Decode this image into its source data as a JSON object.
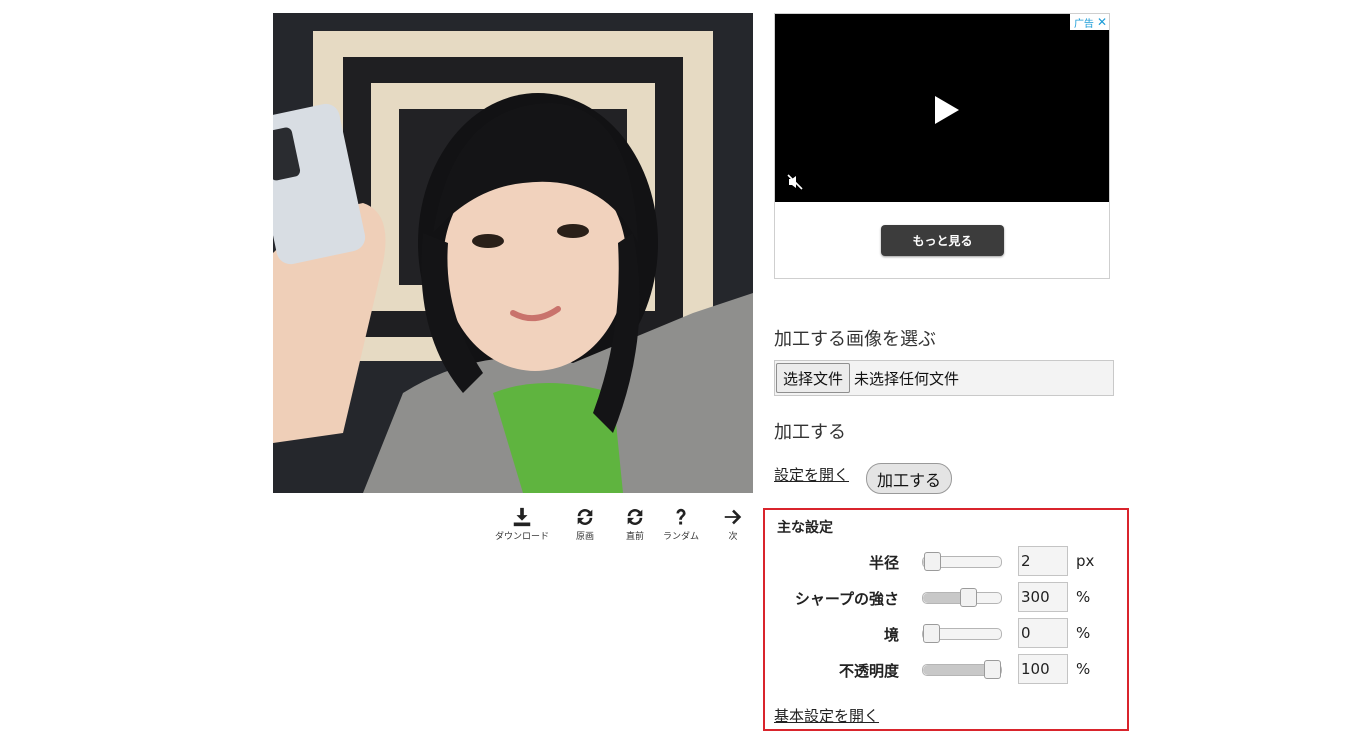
{
  "toolbar": {
    "items": [
      {
        "label": "ダウンロード",
        "icon": "download-icon"
      },
      {
        "label": "原画",
        "icon": "refresh-icon"
      },
      {
        "label": "直前",
        "icon": "refresh-icon"
      },
      {
        "label": "ランダム",
        "icon": "question-icon"
      },
      {
        "label": "次",
        "icon": "arrow-right-icon"
      }
    ]
  },
  "ad": {
    "badge": "广告",
    "close": "✕",
    "more_label": "もっと見る"
  },
  "form": {
    "choose_heading": "加工する画像を選ぶ",
    "file_button": "选择文件",
    "file_status": "未选择任何文件",
    "process_heading": "加工する",
    "open_settings": "設定を開く",
    "process_button": "加工する"
  },
  "settings": {
    "title": "主な設定",
    "rows": [
      {
        "label": "半径",
        "value": "2",
        "unit": "px",
        "slider_fraction": 0.02
      },
      {
        "label": "シャープの強さ",
        "value": "300",
        "unit": "%",
        "slider_fraction": 0.6
      },
      {
        "label": "境",
        "value": "0",
        "unit": "%",
        "slider_fraction": 0.0
      },
      {
        "label": "不透明度",
        "value": "100",
        "unit": "%",
        "slider_fraction": 1.0
      }
    ],
    "basic_link": "基本設定を開く"
  },
  "colors": {
    "highlight_border": "#d9242c",
    "ad_badge": "#1a9bd7"
  }
}
